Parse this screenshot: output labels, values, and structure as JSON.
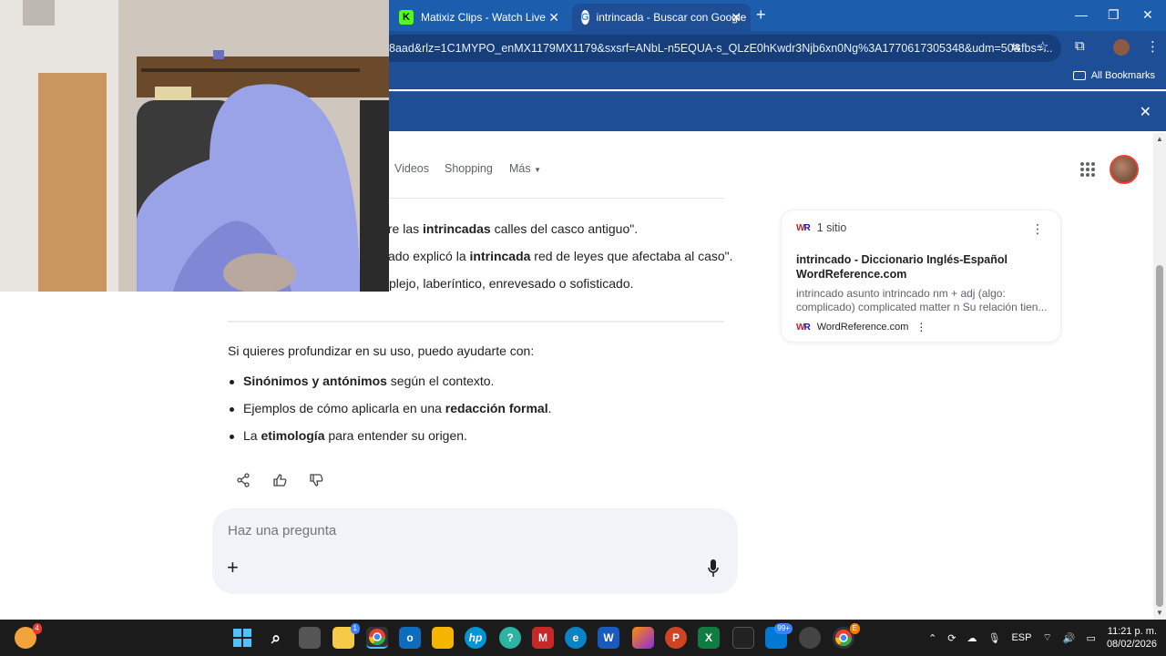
{
  "browser": {
    "tabs": [
      {
        "title": "Matixiz Clips - Watch Live on Ki",
        "favicon": "kick-icon",
        "active": false
      },
      {
        "title": "intrincada - Buscar con Google",
        "favicon": "google-icon",
        "active": true
      }
    ],
    "url": "8aad&rlz=1C1MYPO_enMX1179MX1179&sxsrf=ANbL-n5EQUA-s_QLzE0hKwdr3Njb6xn0Ng%3A1770617305348&udm=50&fbs=...",
    "bookmarks_label": "All Bookmarks"
  },
  "nav": {
    "links": [
      "Videos",
      "Shopping",
      "Más"
    ]
  },
  "answer": {
    "lines": [
      {
        "pre": "tre las ",
        "bold": "intrincadas",
        "post": " calles del casco antiguo\"."
      },
      {
        "pre": "ado explicó la ",
        "bold": "intrincada",
        "post": " red de leyes que afectaba al caso\"."
      },
      {
        "pre": "plejo, laberíntico, enrevesado o sofisticado.",
        "bold": "",
        "post": ""
      }
    ],
    "intro": "Si quieres profundizar en su uso, puedo ayudarte con:",
    "bullets": [
      {
        "pre": "",
        "bold": "Sinónimos y antónimos",
        "post": " según el contexto."
      },
      {
        "pre": "Ejemplos de cómo aplicarla en una ",
        "bold": "redacción formal",
        "post": "."
      },
      {
        "pre": "La ",
        "bold": "etimología",
        "post": " para entender su origen."
      }
    ]
  },
  "ask": {
    "placeholder": "Haz una pregunta"
  },
  "card": {
    "sites": "1 sitio",
    "title": "intrincado - Diccionario Inglés-Español WordReference.com",
    "snippet": "intrincado asunto intrincado nm + adj (algo: complicado) complicated matter n Su relación tien...",
    "source": "WordReference.com",
    "logo": "WR"
  },
  "taskbar": {
    "weather_badge": "4",
    "store_badge": "1",
    "mail_badge": "99+",
    "chrome_badge": "E",
    "lang": "ESP",
    "time": "11:21 p. m.",
    "date": "08/02/2026"
  }
}
